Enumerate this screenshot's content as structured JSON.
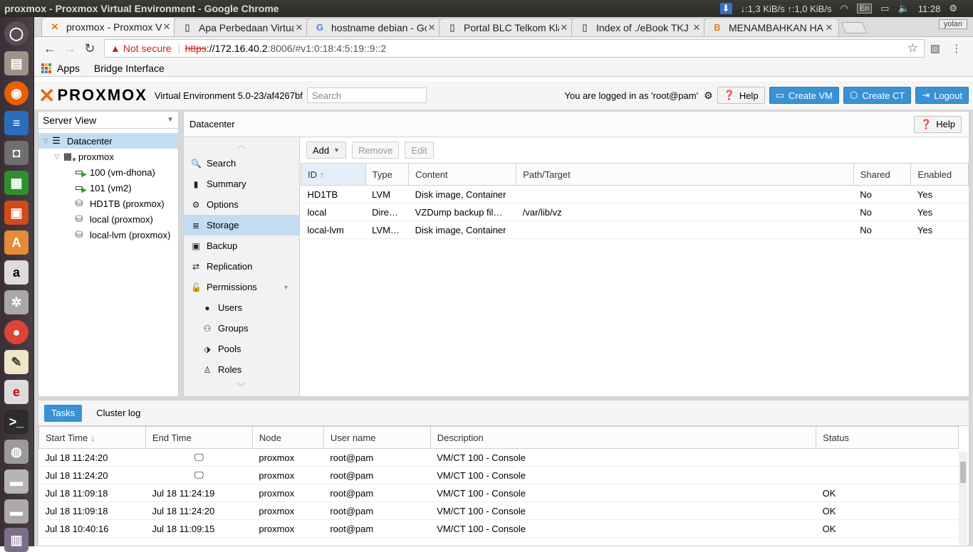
{
  "os": {
    "window_title": "proxmox - Proxmox Virtual Environment - Google Chrome",
    "net_speed": "↓:1,3 KiB/s ↑:1,0 KiB/s",
    "lang": "En",
    "clock": "11:28"
  },
  "browser": {
    "tabs": [
      {
        "title": "proxmox - Proxmox Virtual Environment",
        "icon": "proxmox-x-icon"
      },
      {
        "title": "Apa Perbedaan Virtualisasi",
        "icon": "page-icon"
      },
      {
        "title": "hostname debian - Google",
        "icon": "google-icon"
      },
      {
        "title": "Portal BLC Telkom Klaten",
        "icon": "page-icon"
      },
      {
        "title": "Index of ./eBook TKJ",
        "icon": "page-icon"
      },
      {
        "title": "MENAMBAHKAN HARDDISK",
        "icon": "blogger-icon"
      }
    ],
    "profile": "yolan",
    "security_label": "Not secure",
    "url_scheme": "https",
    "url_host": "://172.16.40.2",
    "url_rest": ":8006/#v1:0:18:4:5:19::9::2",
    "bookmarks": [
      "Apps",
      "Bridge Interface"
    ]
  },
  "pve": {
    "logo": "PROXMOX",
    "version": "Virtual Environment 5.0-23/af4267bf",
    "search_placeholder": "Search",
    "logged_in": "You are logged in as 'root@pam'",
    "help": "Help",
    "create_vm": "Create VM",
    "create_ct": "Create CT",
    "logout": "Logout",
    "server_view": "Server View",
    "tree": [
      {
        "label": "Datacenter",
        "level": 0,
        "icon": "datacenter-icon",
        "selected": true
      },
      {
        "label": "proxmox",
        "level": 1,
        "icon": "node-icon"
      },
      {
        "label": "100 (vm-dhona)",
        "level": 2,
        "icon": "vm-running-icon"
      },
      {
        "label": "101 (vm2)",
        "level": 2,
        "icon": "vm-running-icon"
      },
      {
        "label": "HD1TB (proxmox)",
        "level": 2,
        "icon": "storage-icon"
      },
      {
        "label": "local (proxmox)",
        "level": 2,
        "icon": "storage-icon"
      },
      {
        "label": "local-lvm (proxmox)",
        "level": 2,
        "icon": "storage-icon"
      }
    ],
    "panel_title": "Datacenter",
    "menu": [
      {
        "label": "Search",
        "icon": "search-icon",
        "sub": false
      },
      {
        "label": "Summary",
        "icon": "book-icon",
        "sub": false
      },
      {
        "label": "Options",
        "icon": "gear-icon",
        "sub": false
      },
      {
        "label": "Storage",
        "icon": "database-icon",
        "sub": false,
        "selected": true
      },
      {
        "label": "Backup",
        "icon": "floppy-icon",
        "sub": false
      },
      {
        "label": "Replication",
        "icon": "retweet-icon",
        "sub": false
      },
      {
        "label": "Permissions",
        "icon": "unlock-icon",
        "sub": false,
        "expand": true
      },
      {
        "label": "Users",
        "icon": "user-icon",
        "sub": true
      },
      {
        "label": "Groups",
        "icon": "users-icon",
        "sub": true
      },
      {
        "label": "Pools",
        "icon": "tags-icon",
        "sub": true
      },
      {
        "label": "Roles",
        "icon": "male-icon",
        "sub": true
      }
    ],
    "toolbar": {
      "add": "Add",
      "remove": "Remove",
      "edit": "Edit"
    },
    "storage_columns": [
      "ID",
      "Type",
      "Content",
      "Path/Target",
      "Shared",
      "Enabled"
    ],
    "storage_rows": [
      [
        "HD1TB",
        "LVM",
        "Disk image, Container",
        "",
        "No",
        "Yes"
      ],
      [
        "local",
        "Dire…",
        "VZDump backup fil…",
        "/var/lib/vz",
        "No",
        "Yes"
      ],
      [
        "local-lvm",
        "LVM…",
        "Disk image, Container",
        "",
        "No",
        "Yes"
      ]
    ],
    "task_tabs": [
      "Tasks",
      "Cluster log"
    ],
    "task_columns": [
      "Start Time",
      "End Time",
      "Node",
      "User name",
      "Description",
      "Status"
    ],
    "task_rows": [
      {
        "start": "Jul 18 11:24:20",
        "end": "",
        "running": true,
        "node": "proxmox",
        "user": "root@pam",
        "desc": "VM/CT 100 - Console",
        "status": ""
      },
      {
        "start": "Jul 18 11:24:20",
        "end": "",
        "running": true,
        "node": "proxmox",
        "user": "root@pam",
        "desc": "VM/CT 100 - Console",
        "status": ""
      },
      {
        "start": "Jul 18 11:09:18",
        "end": "Jul 18 11:24:19",
        "running": false,
        "node": "proxmox",
        "user": "root@pam",
        "desc": "VM/CT 100 - Console",
        "status": "OK"
      },
      {
        "start": "Jul 18 11:09:18",
        "end": "Jul 18 11:24:20",
        "running": false,
        "node": "proxmox",
        "user": "root@pam",
        "desc": "VM/CT 100 - Console",
        "status": "OK"
      },
      {
        "start": "Jul 18 10:40:16",
        "end": "Jul 18 11:09:15",
        "running": false,
        "node": "proxmox",
        "user": "root@pam",
        "desc": "VM/CT 100 - Console",
        "status": "OK"
      }
    ]
  }
}
